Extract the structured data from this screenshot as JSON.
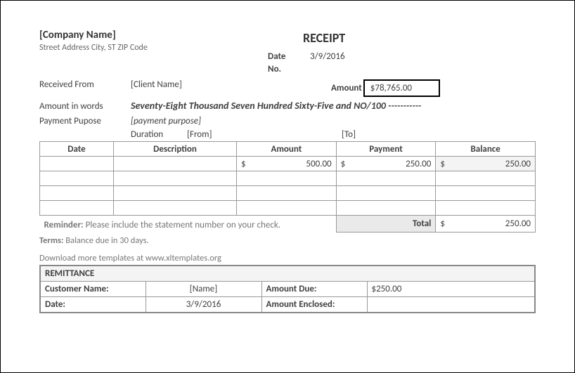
{
  "company": {
    "name": "[Company Name]",
    "address": "Street Address City, ST ZIP Code"
  },
  "title": "RECEIPT",
  "dateLabel": "Date",
  "noLabel": "No.",
  "date": "3/9/2016",
  "receivedFromLabel": "Received From",
  "clientName": "[Client Name]",
  "amountLabel": "Amount",
  "amount": "$78,765.00",
  "amountInWordsLabel": "Amount in words",
  "amountInWords": "Seventy-Eight Thousand Seven Hundred Sixty-Five and NO/100 -----------",
  "paymentPurposeLabel": "Payment Pupose",
  "paymentPurpose": "[payment purpose]",
  "durationLabel": "Duration",
  "durationFrom": "[From]",
  "durationTo": "[To]",
  "table": {
    "headers": {
      "date": "Date",
      "desc": "Description",
      "amount": "Amount",
      "payment": "Payment",
      "balance": "Balance"
    },
    "rows": [
      {
        "date": "",
        "desc": "",
        "amount": "500.00",
        "payment": "250.00",
        "balance": "250.00",
        "cur": "$"
      },
      {
        "date": "",
        "desc": "",
        "amount": "",
        "payment": "",
        "balance": "",
        "cur": ""
      },
      {
        "date": "",
        "desc": "",
        "amount": "",
        "payment": "",
        "balance": "",
        "cur": ""
      },
      {
        "date": "",
        "desc": "",
        "amount": "",
        "payment": "",
        "balance": "",
        "cur": ""
      }
    ],
    "totalLabel": "Total",
    "totalCur": "$",
    "totalVal": "250.00"
  },
  "reminderLabel": "Reminder:",
  "reminderText": " Please include the statement number on your check.",
  "termsLabel": "Terms:",
  "termsText": " Balance due in 30 days.",
  "download": "Download more templates at www.xltemplates.org",
  "remit": {
    "title": "REMITTANCE",
    "custLabel": "Customer Name:",
    "custName": "[Name]",
    "amountDueLabel": "Amount Due:",
    "amountDue": "$250.00",
    "dateLabel": "Date:",
    "date": "3/9/2016",
    "amountEnclosedLabel": "Amount Enclosed:"
  }
}
